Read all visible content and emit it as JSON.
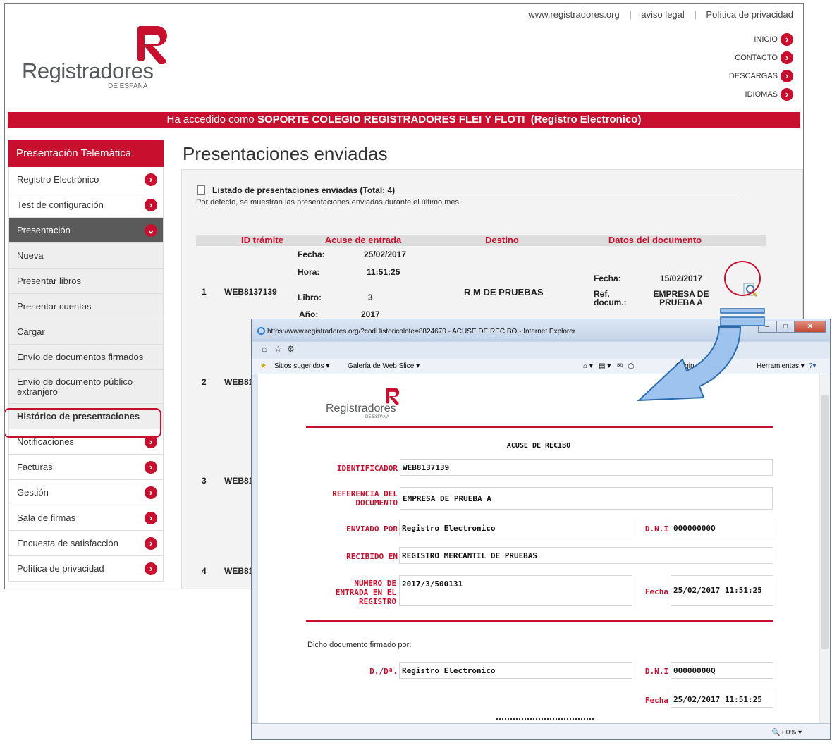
{
  "top_links": [
    "www.registradores.org",
    "aviso legal",
    "Política de privacidad"
  ],
  "logo": {
    "name": "Registradores",
    "sub": "DE ESPAÑA"
  },
  "right_nav": [
    "INICIO",
    "CONTACTO",
    "DESCARGAS",
    "IDIOMAS"
  ],
  "banner": {
    "prefix": "Ha accedido como",
    "user": "SOPORTE COLEGIO REGISTRADORES FLEI Y FLOTI",
    "mode": "(Registro Electronico)"
  },
  "sidebar": {
    "title": "Presentación Telemática",
    "items": [
      {
        "label": "Registro Electrónico"
      },
      {
        "label": "Test de configuración"
      },
      {
        "label": "Presentación"
      },
      {
        "label": "Nueva"
      },
      {
        "label": "Presentar libros"
      },
      {
        "label": "Presentar cuentas"
      },
      {
        "label": "Cargar"
      },
      {
        "label": "Envío de documentos firmados"
      },
      {
        "label": "Envío de documento público extranjero"
      },
      {
        "label": "Histórico de presentaciones"
      },
      {
        "label": "Notificaciones"
      },
      {
        "label": "Facturas"
      },
      {
        "label": "Gestión"
      },
      {
        "label": "Sala de firmas"
      },
      {
        "label": "Encuesta de satisfacción"
      },
      {
        "label": "Política de privacidad"
      }
    ]
  },
  "content": {
    "title": "Presentaciones enviadas",
    "list_title": "Listado de presentaciones enviadas  (Total: 4)",
    "list_note": "Por defecto, se muestran las presentaciones enviadas durante el último mes",
    "columns": [
      "ID trámite",
      "Acuse de entrada",
      "Destino",
      "Datos del documento"
    ],
    "row1": {
      "n": "1",
      "id": "WEB8137139",
      "fecha_l": "Fecha:",
      "fecha": "25/02/2017",
      "hora_l": "Hora:",
      "hora": "11:51:25",
      "libro_l": "Libro:",
      "libro": "3",
      "anio_l": "Año:",
      "anio": "2017",
      "destino": "R M DE PRUEBAS",
      "dfecha_l": "Fecha:",
      "dfecha": "15/02/2017",
      "ref_l": "Ref. docum.:",
      "ref": "EMPRESA DE PRUEBA A"
    },
    "other_rows": [
      {
        "n": "2",
        "id": "WEB813"
      },
      {
        "n": "3",
        "id": "WEB813"
      },
      {
        "n": "4",
        "id": "WEB813"
      }
    ]
  },
  "popup": {
    "title": "https://www.registradores.org/?codHistoricolote=8824670 - ACUSE DE RECIBO - Internet Explorer",
    "favorites": [
      "Sitios sugeridos ▾",
      "Galería de Web Slice ▾"
    ],
    "tools": [
      "Págin",
      "Herramientas ▾"
    ],
    "zoom": "80%",
    "doc": {
      "heading": "ACUSE DE RECIBO",
      "identificador_l": "IDENTIFICADOR",
      "identificador": "WEB8137139",
      "referencia_l": "REFERENCIA DEL DOCUMENTO",
      "referencia": "EMPRESA DE PRUEBA A",
      "enviado_l": "ENVIADO POR",
      "enviado": "Registro Electronico",
      "dni_l": "D.N.I",
      "dni": "00000000Q",
      "recibido_l": "RECIBIDO EN",
      "recibido": "REGISTRO MERCANTIL DE PRUEBAS",
      "numero_l": "NÚMERO DE ENTRADA EN EL REGISTRO",
      "numero": "2017/3/500131",
      "fecha_l": "Fecha",
      "fecha": "25/02/2017 11:51:25",
      "firmado": "Dicho documento firmado por:",
      "dd_l": "D./Dª.",
      "dd": "Registro Electronico",
      "dni2_l": "D.N.I",
      "dni2": "00000000Q",
      "fecha2_l": "Fecha",
      "fecha2": "25/02/2017 11:51:25"
    }
  },
  "colors": {
    "brand_red": "#c8102e",
    "active_gray": "#5a5a5a"
  }
}
